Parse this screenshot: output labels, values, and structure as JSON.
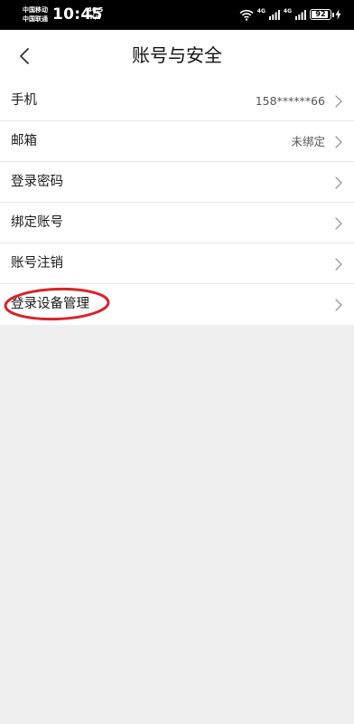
{
  "status_bar": {
    "carrier_line1": "中国移动",
    "carrier_line2": "中国联通",
    "time": "10:45",
    "net_speed_value": "46.5",
    "net_speed_unit": "K/s",
    "net_tag_1": "4G",
    "net_tag_2": "4G",
    "battery_level": 92,
    "battery_text": "92",
    "icons": [
      "wifi-icon",
      "signal-icon",
      "signal-icon",
      "battery-icon",
      "charging-bolt-icon"
    ]
  },
  "header": {
    "title": "账号与安全",
    "back_icon": "chevron-left-icon"
  },
  "settings": {
    "items": [
      {
        "label": "手机",
        "value": "158******66"
      },
      {
        "label": "邮箱",
        "value": "未绑定"
      },
      {
        "label": "登录密码",
        "value": ""
      },
      {
        "label": "绑定账号",
        "value": ""
      },
      {
        "label": "账号注销",
        "value": ""
      },
      {
        "label": "登录设备管理",
        "value": "",
        "highlighted": true
      }
    ],
    "row_icon": "chevron-right-icon"
  },
  "colors": {
    "annotation": "#d8242a",
    "background": "#efefef",
    "surface": "#ffffff",
    "status_bar": "#000000"
  }
}
